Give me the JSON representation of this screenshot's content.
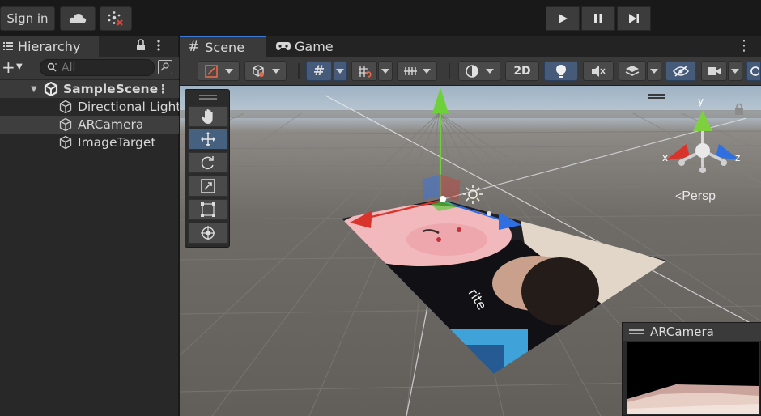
{
  "topbar": {
    "signin_label": "Sign in",
    "cloud_icon": "cloud-icon",
    "collab_icon": "collab-error-icon",
    "play_icon": "play-icon",
    "pause_icon": "pause-icon",
    "step_icon": "step-icon"
  },
  "hierarchy": {
    "tab_label": "Hierarchy",
    "search_placeholder": "All",
    "scene_name": "SampleScene",
    "items": [
      {
        "label": "Directional Light",
        "selected": false
      },
      {
        "label": "ARCamera",
        "selected": true
      },
      {
        "label": "ImageTarget",
        "selected": false
      }
    ]
  },
  "scene": {
    "tabs": [
      {
        "label": "Scene",
        "icon": "hash-icon",
        "active": true
      },
      {
        "label": "Game",
        "icon": "gamepad-icon",
        "active": false
      }
    ],
    "toolbar": {
      "mode_2d_label": "2D"
    },
    "view": {
      "projection_label": "Persp",
      "axis_x": "x",
      "axis_y": "y",
      "axis_z": "z"
    },
    "camera_preview_title": "ARCamera"
  },
  "colors": {
    "accent": "#3d7bd6",
    "axis_x": "#d9342b",
    "axis_y": "#6fd13a",
    "axis_z": "#2f6fe0",
    "panel": "#282828",
    "toolbar": "#3a3a3a"
  }
}
